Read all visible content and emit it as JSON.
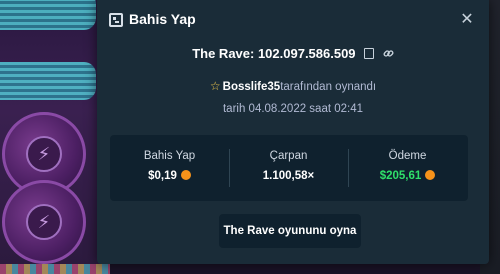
{
  "modal": {
    "title": "Bahis Yap",
    "game_line": "The Rave: 102.097.586.509",
    "player_name": "Bosslife35",
    "player_suffix": "tarafından oynandı",
    "date_line": "tarih 04.08.2022 saat 02:41",
    "stats": [
      {
        "label": "Bahis Yap",
        "value": "$0,19",
        "currency_icon": "bitcoin-icon"
      },
      {
        "label": "Çarpan",
        "value": "1.100,58×"
      },
      {
        "label": "Ödeme",
        "value": "$205,61",
        "currency_icon": "bitcoin-icon",
        "color": "#2fe06a"
      }
    ],
    "play_button": "The Rave oyununu oyna"
  },
  "icons": {
    "header": "bet-slip-icon",
    "close": "close-icon",
    "copy": "copy-icon",
    "link": "link-icon",
    "star": "star-icon"
  },
  "colors": {
    "modal_bg": "#1a2c38",
    "stats_bg": "#0f212e",
    "muted_text": "#b1bad3",
    "payout_green": "#2fe06a",
    "star_yellow": "#f2c94c",
    "coin_orange": "#f7931a"
  }
}
